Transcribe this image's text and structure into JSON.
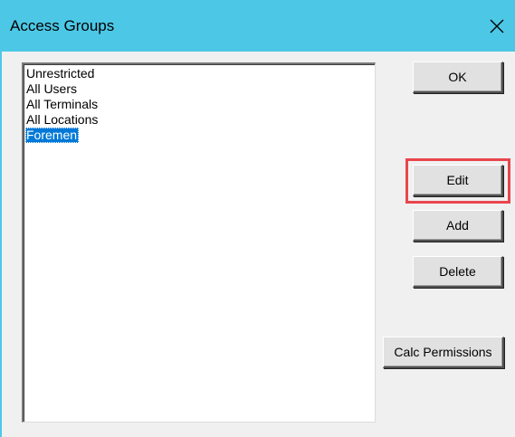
{
  "window": {
    "title": "Access Groups",
    "titlebar_color": "#4cc8e6",
    "close_icon": "close-icon"
  },
  "list": {
    "items": [
      {
        "label": "Unrestricted",
        "selected": false
      },
      {
        "label": "All Users",
        "selected": false
      },
      {
        "label": "All Terminals",
        "selected": false
      },
      {
        "label": "All Locations",
        "selected": false
      },
      {
        "label": "Foremen",
        "selected": true
      }
    ],
    "selection_color": "#0078d7"
  },
  "buttons": {
    "ok": "OK",
    "edit": "Edit",
    "add": "Add",
    "delete": "Delete",
    "calc_permissions": "Calc Permissions"
  },
  "annotation": {
    "highlight_target": "edit",
    "highlight_color": "#e8464e"
  }
}
